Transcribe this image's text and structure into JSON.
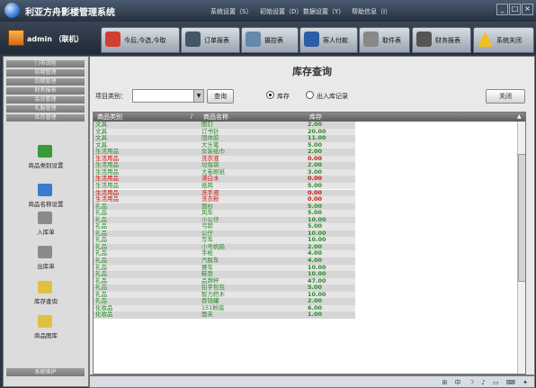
{
  "app": {
    "title": "利亚方舟影楼管理系统",
    "menu": [
      "系统设置（S）",
      "初始设置（D）",
      "数据设置（Y）",
      "帮助信息（I）"
    ],
    "window_buttons": [
      "_",
      "□",
      "×"
    ]
  },
  "user": {
    "label": "admin （联机）"
  },
  "toolbar": [
    {
      "label": "今后,今选,今取",
      "color": "#d04030"
    },
    {
      "label": "订单报表",
      "color": "#445566"
    },
    {
      "label": "摄控表",
      "color": "#6688aa"
    },
    {
      "label": "客人付款",
      "color": "#2a5fa8"
    },
    {
      "label": "取件表",
      "color": "#888888"
    },
    {
      "label": "财务报表",
      "color": "#555555"
    },
    {
      "label": "系统关闭",
      "color": "#f0c020"
    }
  ],
  "sidebar": {
    "nav": [
      "门市流程",
      "前期管理",
      "后期管理",
      "财务报表",
      "会员管理",
      "礼服管理",
      "库存管理"
    ],
    "tools": [
      {
        "label": "商品类别设置",
        "icon": "category-icon",
        "color": "#3a9a3a"
      },
      {
        "label": "商品名称设置",
        "icon": "goods-name-icon",
        "color": "#3a7ad0"
      },
      {
        "label": "入库单",
        "icon": "stock-in-icon",
        "color": "#8a8a8a"
      },
      {
        "label": "出库单",
        "icon": "stock-out-icon",
        "color": "#8a8a8a"
      },
      {
        "label": "库存查询",
        "icon": "stock-query-icon",
        "color": "#e0c040"
      },
      {
        "label": "商品图库",
        "icon": "gallery-icon",
        "color": "#e0c040"
      }
    ],
    "bottom": "系统维护"
  },
  "main": {
    "title": "库存查询",
    "type_label": "项目类别：",
    "select_value": "",
    "query_button": "查询",
    "radio_stock": "库存",
    "radio_records": "出入库记录",
    "close_button": "关闭",
    "columns": [
      "商品类别",
      "商品名称",
      "库存"
    ],
    "rows": [
      [
        "文具",
        "图钉",
        "2.00"
      ],
      [
        "文具",
        "订书针",
        "20.00"
      ],
      [
        "文具",
        "固体胶",
        "11.00"
      ],
      [
        "文具",
        "大头笔",
        "5.00"
      ],
      [
        "生活用品",
        "女装纸巾",
        "2.00"
      ],
      [
        "生活用品",
        "洗衣液",
        "0.00"
      ],
      [
        "生活用品",
        "垃圾袋",
        "2.00"
      ],
      [
        "生活用品",
        "大卷厕纸",
        "3.00"
      ],
      [
        "生活用品",
        "漂白水",
        "0.00"
      ],
      [
        "生活用品",
        "纸简",
        "5.00"
      ],
      [
        "生活用品",
        "洗手液",
        "0.00"
      ],
      [
        "生活用品",
        "洗衣粉",
        "0.00"
      ],
      [
        "礼品",
        "面纱",
        "5.00"
      ],
      [
        "礼品",
        "风车",
        "5.00"
      ],
      [
        "礼品",
        "小公仔",
        "10.00"
      ],
      [
        "礼品",
        "弓箭",
        "5.00"
      ],
      [
        "礼品",
        "公仔",
        "10.00"
      ],
      [
        "礼品",
        "写车",
        "10.00"
      ],
      [
        "礼品",
        "小号帆船",
        "2.00"
      ],
      [
        "礼品",
        "手枪",
        "4.00"
      ],
      [
        "礼品",
        "汽艇车",
        "4.00"
      ],
      [
        "礼品",
        "赛车",
        "10.00"
      ],
      [
        "礼品",
        "鞋垫",
        "10.00"
      ],
      [
        "礼品",
        "品牌杯",
        "47.00"
      ],
      [
        "礼品",
        "铅字包包",
        "5.00"
      ],
      [
        "礼品",
        "智力积木",
        "10.00"
      ],
      [
        "礼品",
        "吞钱罐",
        "2.00"
      ],
      [
        "化妆品",
        "151粉底",
        "6.00"
      ],
      [
        "化妆品",
        "面夹",
        "1.00"
      ]
    ],
    "highlight_color": "#cc1111",
    "normal_color": "#2a8a2a"
  },
  "status": {
    "tray": "⊞ 中 ☽ ♪ ▭ ⌨ ✦"
  }
}
